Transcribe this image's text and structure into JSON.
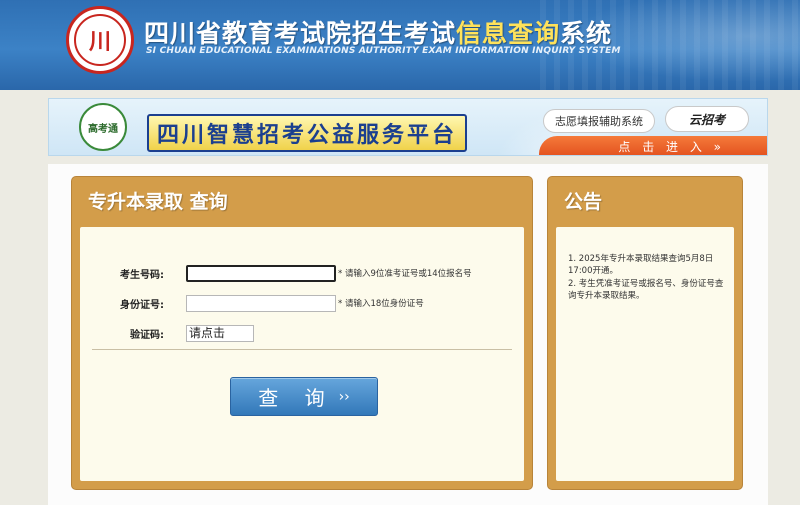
{
  "header": {
    "logo_text": "川",
    "title_main": "四川省教育考试院招生考试",
    "title_highlight": "信息查询",
    "title_tail": "系统",
    "subtitle": "SI CHUAN EDUCATIONAL EXAMINATIONS AUTHORITY EXAM INFORMATION INQUIRY SYSTEM"
  },
  "banner": {
    "logo_text": "高考通",
    "title": "四川智慧招考公益服务平台",
    "button_volunteer": "志愿填报辅助系统",
    "button_brand": "云招考",
    "enter_label": "点 击 进 入",
    "enter_arrow": "»"
  },
  "form": {
    "title": "专升本录取 查询",
    "exam_no_label": "考生号码:",
    "exam_no_hint": "* 请输入9位准考证号或14位报名号",
    "id_no_label": "身份证号:",
    "id_no_hint": "* 请输入18位身份证号",
    "captcha_label": "验证码:",
    "captcha_value": "请点击",
    "query_label": "查 询",
    "query_arrow": "››"
  },
  "notice": {
    "title": "公告",
    "items": [
      "1. 2025年专升本录取结果查询5月8日17:00开通。",
      "2. 考生凭准考证号或报名号、身份证号查询专升本录取结果。"
    ]
  },
  "colors": {
    "header_blue": "#3c82c6",
    "panel_orange": "#d39d4a",
    "panel_body": "#fdfbec",
    "button_blue": "#3278b9",
    "enter_orange": "#e2501e"
  }
}
